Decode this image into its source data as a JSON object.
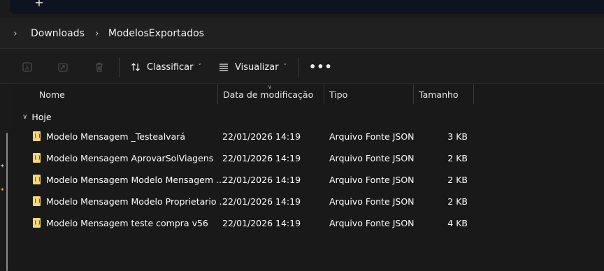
{
  "tabstrip": {
    "new_tab_label": "+"
  },
  "breadcrumb": {
    "items": [
      "Downloads",
      "ModelosExportados"
    ]
  },
  "toolbar": {
    "sort_label": "Classificar",
    "view_label": "Visualizar",
    "more_label": "•••"
  },
  "columns": {
    "name": "Nome",
    "date": "Data de modificação",
    "type": "Tipo",
    "size": "Tamanho"
  },
  "group": {
    "label": "Hoje"
  },
  "files": [
    {
      "name": "Modelo Mensagem _Testealvará",
      "date": "22/01/2026 14:19",
      "type": "Arquivo Fonte JSON",
      "size": "3 KB"
    },
    {
      "name": "Modelo Mensagem AprovarSolViagens",
      "date": "22/01/2026 14:19",
      "type": "Arquivo Fonte JSON",
      "size": "2 KB"
    },
    {
      "name": "Modelo Mensagem Modelo Mensagem ...",
      "date": "22/01/2026 14:19",
      "type": "Arquivo Fonte JSON",
      "size": "2 KB"
    },
    {
      "name": "Modelo Mensagem Modelo Proprietario ...",
      "date": "22/01/2026 14:19",
      "type": "Arquivo Fonte JSON",
      "size": "2 KB"
    },
    {
      "name": "Modelo Mensagem teste compra v56",
      "date": "22/01/2026 14:19",
      "type": "Arquivo Fonte JSON",
      "size": "4 KB"
    }
  ],
  "icons": {
    "file": "json-file-icon",
    "sort": "sort-arrows-icon",
    "view": "view-lines-icon"
  }
}
